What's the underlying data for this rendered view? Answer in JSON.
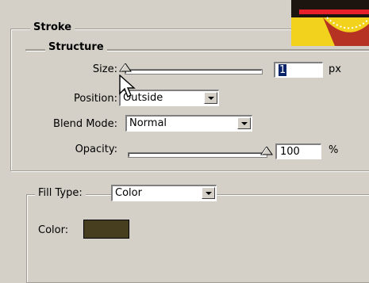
{
  "stroke": {
    "title": "Stroke"
  },
  "structure": {
    "title": "Structure",
    "size": {
      "label": "Size:",
      "value": "1",
      "unit": "px",
      "slider_fraction": 0.0
    },
    "position": {
      "label": "Position:",
      "value": "Outside"
    },
    "blend_mode": {
      "label": "Blend Mode:",
      "value": "Normal"
    },
    "opacity": {
      "label": "Opacity:",
      "value": "100",
      "unit": "%",
      "slider_fraction": 1.0
    }
  },
  "fill": {
    "type_label": "Fill Type:",
    "type_value": "Color",
    "color_label": "Color:",
    "color": "#463e1e"
  },
  "colors": {
    "panel": "#d4d0c8",
    "selection": "#0a246a"
  },
  "icons": {
    "cursor": "arrow-pointer-icon",
    "preview": "layer-preview-thumbnail"
  }
}
